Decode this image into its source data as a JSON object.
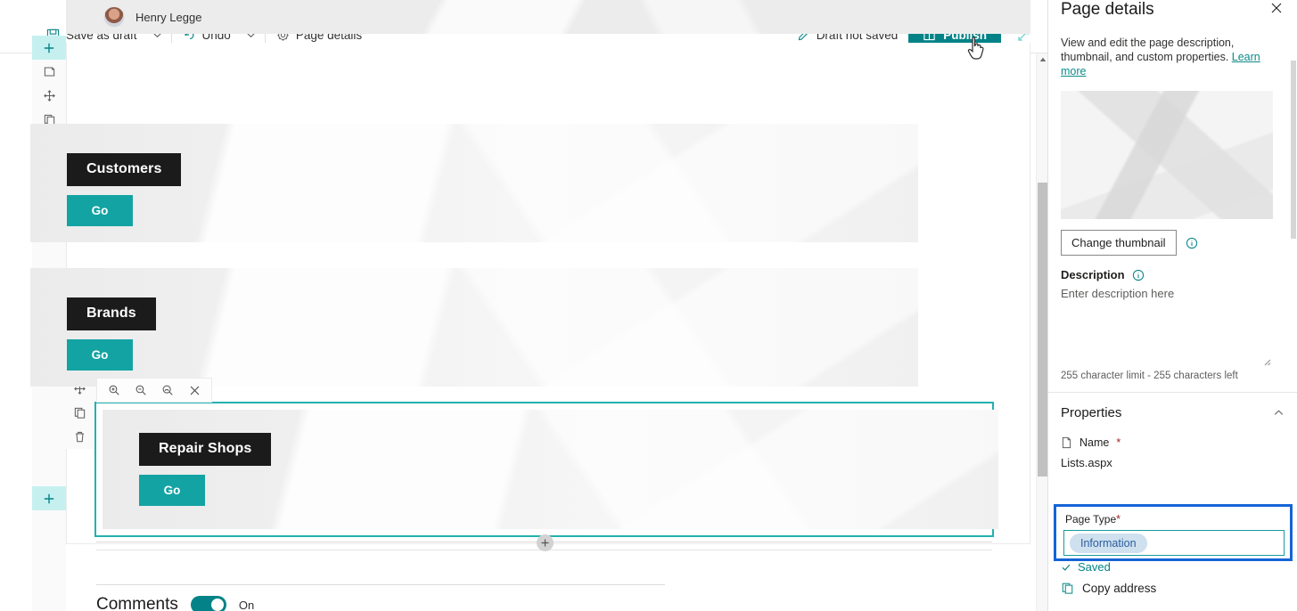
{
  "toolbar": {
    "save_draft_label": "Save as draft",
    "save_icon": "save-disk-icon",
    "undo_label": "Undo",
    "undo_icon": "undo-arrow-icon",
    "page_details_label": "Page details",
    "page_details_icon": "gear-icon",
    "chevron_icon": "chevron-down-icon",
    "draft_status": "Draft not saved",
    "draft_status_icon": "pencil-icon",
    "publish_label": "Publish",
    "publish_icon": "book-icon",
    "publish_color": "#038387",
    "expand_icon": "expand-diagonal-icon"
  },
  "canvas": {
    "author_name": "Henry Legge",
    "left_rail": [
      {
        "name": "add-section",
        "icon": "plus-icon",
        "active": true
      },
      {
        "name": "edit-section",
        "icon": "note-edit-icon",
        "active": false
      },
      {
        "name": "move-section",
        "icon": "move-arrows-icon",
        "active": false
      },
      {
        "name": "duplicate-section",
        "icon": "duplicate-icon",
        "active": false
      },
      {
        "name": "delete-section",
        "icon": "trash-icon",
        "active": false
      }
    ],
    "section_rail": [
      {
        "name": "edit-webpart",
        "icon": "pencil-icon"
      },
      {
        "name": "move-webpart",
        "icon": "move-arrows-icon"
      },
      {
        "name": "duplicate-webpart",
        "icon": "duplicate-icon"
      },
      {
        "name": "delete-webpart",
        "icon": "trash-icon"
      }
    ],
    "zoom_toolbar": [
      {
        "name": "zoom-in",
        "icon": "magnifier-plus-icon"
      },
      {
        "name": "zoom-out",
        "icon": "magnifier-minus-icon"
      },
      {
        "name": "reset-zoom",
        "icon": "magnifier-reset-icon"
      },
      {
        "name": "close-toolbar",
        "icon": "close-icon"
      }
    ],
    "cards": [
      {
        "title": "Customers",
        "button": "Go",
        "selected": false
      },
      {
        "title": "Brands",
        "button": "Go",
        "selected": false
      },
      {
        "title": "Repair Shops",
        "button": "Go",
        "selected": true
      }
    ],
    "add_section_icon": "plus-icon",
    "bottom_add_icon": "plus-icon",
    "comments_label": "Comments",
    "comments_state": "On",
    "accent_teal": "#13a3a3",
    "selection_teal": "#25b0b0"
  },
  "panel": {
    "title": "Page details",
    "close_icon": "close-icon",
    "description_intro": "View and edit the page description, thumbnail, and custom properties.",
    "learn_more": "Learn more",
    "change_thumbnail_label": "Change thumbnail",
    "info_icon": "info-circle-icon",
    "description_label": "Description",
    "description_placeholder": "Enter description here",
    "description_value": "",
    "char_count": "255 character limit - 255 characters left",
    "properties_title": "Properties",
    "collapse_icon": "chevron-up-icon",
    "name_label": "Name",
    "name_required": "*",
    "name_icon": "page-icon",
    "name_value": "Lists.aspx",
    "page_type_label": "Page Type",
    "page_type_required": "*",
    "page_type_value": "Information",
    "highlight_color": "#1464d6",
    "field_border_color": "#179c9c",
    "saved_label": "Saved",
    "saved_icon": "check-icon",
    "copy_address_label": "Copy address",
    "copy_address_icon": "copy-icon"
  }
}
